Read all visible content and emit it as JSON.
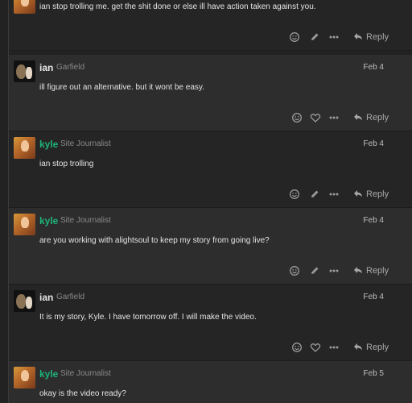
{
  "colors": {
    "background": "#222222",
    "post_light": "#2d2d2d",
    "post_dark": "#252525",
    "username_kyle": "#1eb57a",
    "text": "#e4e4e4",
    "muted": "#8a8a8a"
  },
  "icons": {
    "like": "smile-icon",
    "heart": "heart-icon",
    "edit": "pencil-icon",
    "more": "ellipsis-icon",
    "reply": "reply-arrow-icon"
  },
  "reply_label": "Reply",
  "posts": [
    {
      "username": "",
      "user_title": "",
      "date": "",
      "body": "ian stop trolling me. get the shit done or else ill have action taken against you.",
      "actions": [
        "smile",
        "edit",
        "more"
      ]
    },
    {
      "username": "ian",
      "user_title": "Garfield",
      "date": "Feb 4",
      "body": "ill figure out an alternative. but it wont be easy.",
      "actions": [
        "smile",
        "heart",
        "more"
      ]
    },
    {
      "username": "kyle",
      "user_title": "Site Journalist",
      "date": "Feb 4",
      "body": "ian stop trolling",
      "actions": [
        "smile",
        "edit",
        "more"
      ]
    },
    {
      "username": "kyle",
      "user_title": "Site Journalist",
      "date": "Feb 4",
      "body": "are you working with alightsoul to keep my story from going live?",
      "actions": [
        "smile",
        "edit",
        "more"
      ]
    },
    {
      "username": "ian",
      "user_title": "Garfield",
      "date": "Feb 4",
      "body": "It is my story, Kyle. I have tomorrow off. I will make the video.",
      "actions": [
        "smile",
        "heart",
        "more"
      ]
    },
    {
      "username": "kyle",
      "user_title": "Site Journalist",
      "date": "Feb 5",
      "body": "okay is the video ready?",
      "actions": []
    }
  ]
}
